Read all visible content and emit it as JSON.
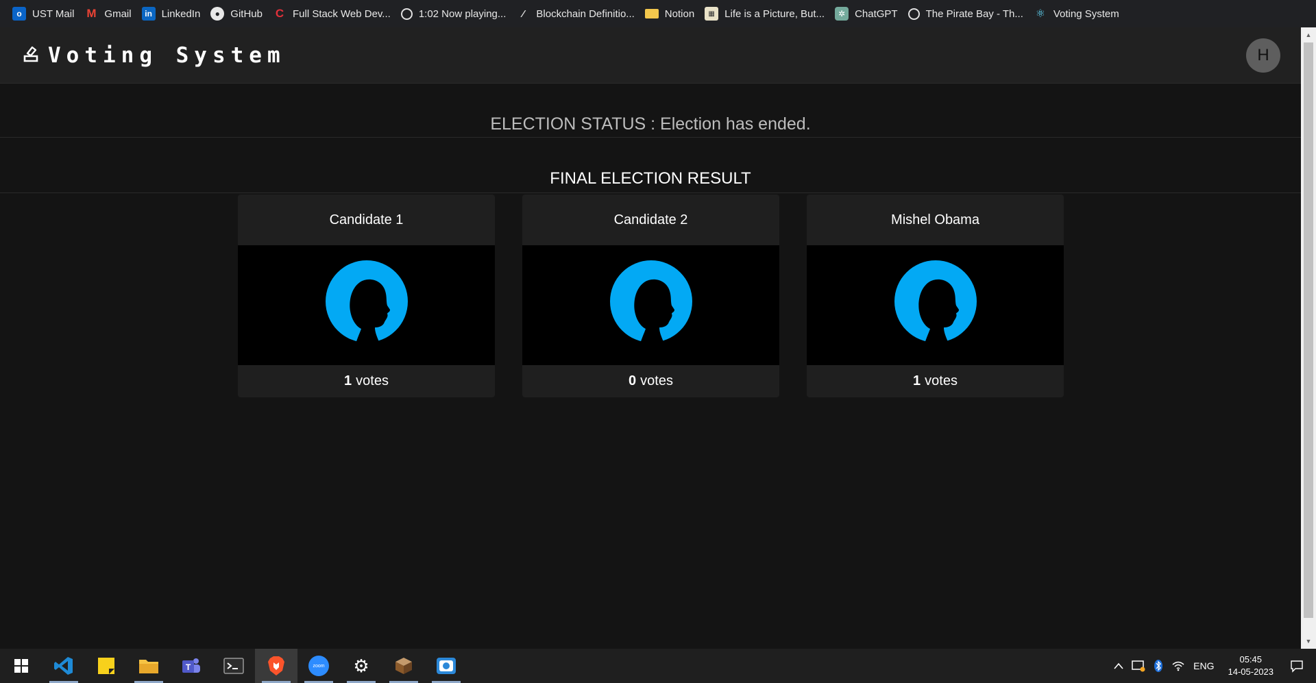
{
  "bookmarks": [
    {
      "label": "UST Mail",
      "icon": "outlook-icon"
    },
    {
      "label": "Gmail",
      "icon": "gmail-icon"
    },
    {
      "label": "LinkedIn",
      "icon": "linkedin-icon"
    },
    {
      "label": "GitHub",
      "icon": "github-icon"
    },
    {
      "label": "Full Stack Web Dev...",
      "icon": "codecademy-icon"
    },
    {
      "label": "1:02 Now playing...",
      "icon": "globe-icon"
    },
    {
      "label": "Blockchain Definitio...",
      "icon": "investopedia-icon"
    },
    {
      "label": "Notion",
      "icon": "folder-icon"
    },
    {
      "label": "Life is a Picture, But...",
      "icon": "comic-icon"
    },
    {
      "label": "ChatGPT",
      "icon": "chatgpt-icon"
    },
    {
      "label": "The Pirate Bay - Th...",
      "icon": "globe-icon"
    },
    {
      "label": "Voting System",
      "icon": "react-icon"
    }
  ],
  "header": {
    "brand": "Voting System",
    "avatar_initial": "H"
  },
  "election": {
    "status": "ELECTION STATUS : Election has ended.",
    "result_title": "FINAL ELECTION RESULT"
  },
  "candidates": [
    {
      "name": "Candidate 1",
      "votes": "1",
      "votes_label": "votes"
    },
    {
      "name": "Candidate 2",
      "votes": "0",
      "votes_label": "votes"
    },
    {
      "name": "Mishel Obama",
      "votes": "1",
      "votes_label": "votes"
    }
  ],
  "taskbar": {
    "apps": [
      "start-icon",
      "vscode-icon",
      "sticky-notes-icon",
      "file-explorer-icon",
      "teams-icon",
      "terminal-icon",
      "brave-icon",
      "zoom-icon",
      "settings-icon",
      "minecraft-icon",
      "screen-capture-icon"
    ],
    "zoom_label": "zoom",
    "language": "ENG",
    "time": "05:45",
    "date": "14-05-2023"
  },
  "colors": {
    "accent": "#03a9f4",
    "background": "#141414",
    "navbar": "#212121",
    "card": "#1f1f1f"
  }
}
